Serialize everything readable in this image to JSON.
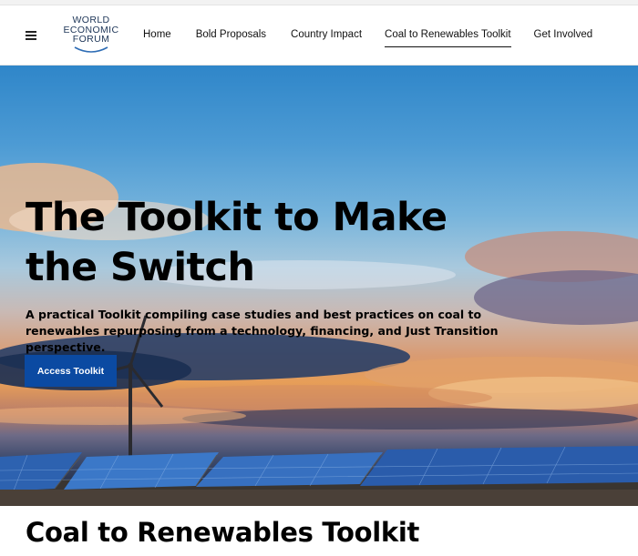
{
  "header": {
    "logo": {
      "lines": [
        "WORLD",
        "ECONOMIC",
        "FORUM"
      ]
    },
    "menu_icon": "hamburger-menu-icon",
    "nav": [
      {
        "label": "Home",
        "active": false
      },
      {
        "label": "Bold Proposals",
        "active": false
      },
      {
        "label": "Country Impact",
        "active": false
      },
      {
        "label": "Coal to Renewables Toolkit",
        "active": true
      },
      {
        "label": "Get Involved",
        "active": false
      }
    ]
  },
  "hero": {
    "title": "The Toolkit to Make the Switch",
    "subtitle": "A practical Toolkit compiling case studies and best practices on coal to renewables repurposing from a technology, financing, and Just Transition perspective.",
    "button_label": "Access Toolkit",
    "button_color": "#0b4aa2",
    "image": "wind-turbine-and-solar-panels-at-sunset"
  },
  "section": {
    "title": "Coal to Renewables Toolkit"
  }
}
